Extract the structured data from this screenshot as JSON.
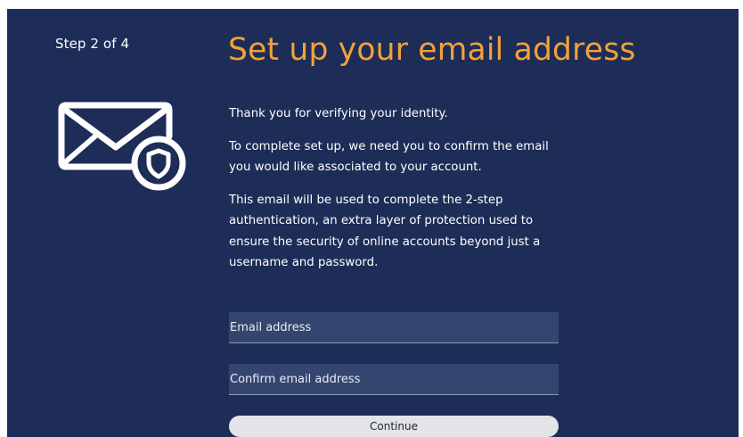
{
  "step_indicator": "Step 2 of 4",
  "icon": "envelope-shield-icon",
  "title": "Set up your email address",
  "paragraphs": [
    "Thank you for verifying your identity.",
    "To complete set up, we need you to confirm the email you would like associated to your account.",
    "This email will be used to complete the 2-step authentication, an extra layer of protection used to ensure the security of online accounts beyond just a username and password."
  ],
  "form": {
    "email_placeholder": "Email address",
    "email_value": "",
    "confirm_placeholder": "Confirm email address",
    "confirm_value": "",
    "continue_label": "Continue"
  },
  "colors": {
    "background": "#1d2d57",
    "title": "#f2a23a",
    "field": "#344670",
    "button": "#e3e4e8"
  }
}
